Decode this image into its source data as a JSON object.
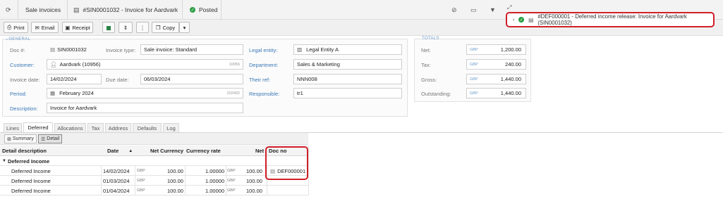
{
  "topbar": {
    "breadcrumb": "Sale invoices",
    "doc_title": "#SIN0001032 - Invoice for Aardvark",
    "status": "Posted"
  },
  "notification": {
    "text": "#DEF000001 - Deferred income release: Invoice for Aardvark (SIN0001032)"
  },
  "toolbar": {
    "print": "Print",
    "email": "Email",
    "receipt": "Receipt",
    "copy": "Copy"
  },
  "general": {
    "legend": "GENERAL",
    "doc_no_label": "Doc #:",
    "doc_no": "SIN0001032",
    "invoice_type_label": "Invoice type:",
    "invoice_type": "Sale invoice: Standard",
    "customer_label": "Customer:",
    "customer": "Aardvark (10956)",
    "customer_code": "10956",
    "invoice_date_label": "Invoice date:",
    "invoice_date": "14/02/2024",
    "due_date_label": "Due date:",
    "due_date": "06/03/2024",
    "period_label": "Period:",
    "period": "February 2024",
    "period_code": "202402",
    "description_label": "Description:",
    "description": "Invoice for Aardvark",
    "legal_entity_label": "Legal entity:",
    "legal_entity": "Legal Entity A",
    "department_label": "Department:",
    "department": "Sales & Marketing",
    "their_ref_label": "Their ref:",
    "their_ref": "NNN008",
    "responsible_label": "Responsible:",
    "responsible": "tr1"
  },
  "totals": {
    "legend": "TOTALS",
    "net_label": "Net:",
    "net_ccy": "GBP",
    "net": "1,200.00",
    "tax_label": "Tax:",
    "tax_ccy": "GBP",
    "tax": "240.00",
    "gross_label": "Gross:",
    "gross_ccy": "GBP",
    "gross": "1,440.00",
    "outstanding_label": "Outstanding:",
    "outstanding_ccy": "GBP",
    "outstanding": "1,440.00"
  },
  "tabs": [
    "Lines",
    "Deferred",
    "Allocations",
    "Tax",
    "Address",
    "Defaults",
    "Log"
  ],
  "subbar": {
    "summary": "Summary",
    "detail": "Detail"
  },
  "grid": {
    "columns": {
      "description": "Detail description",
      "date": "Date",
      "net_currency": "Net Currency",
      "currency_rate": "Currency rate",
      "net": "Net",
      "doc_no": "Doc no"
    },
    "group": "Deferred Income",
    "rows": [
      {
        "description": "Deferred Income",
        "date": "14/02/2024",
        "ccy1": "GBP",
        "net_currency": "100.00",
        "rate": "1.00000",
        "ccy2": "GBP",
        "net": "100.00",
        "doc_no": "DEF000001"
      },
      {
        "description": "Deferred Income",
        "date": "01/03/2024",
        "ccy1": "GBP",
        "net_currency": "100.00",
        "rate": "1.00000",
        "ccy2": "GBP",
        "net": "100.00",
        "doc_no": ""
      },
      {
        "description": "Deferred Income",
        "date": "01/04/2024",
        "ccy1": "GBP",
        "net_currency": "100.00",
        "rate": "1.00000",
        "ccy2": "GBP",
        "net": "100.00",
        "doc_no": ""
      }
    ]
  },
  "colors": {
    "highlight": "#d0202a",
    "link": "#3a78b5",
    "posted": "#2e9e44"
  }
}
